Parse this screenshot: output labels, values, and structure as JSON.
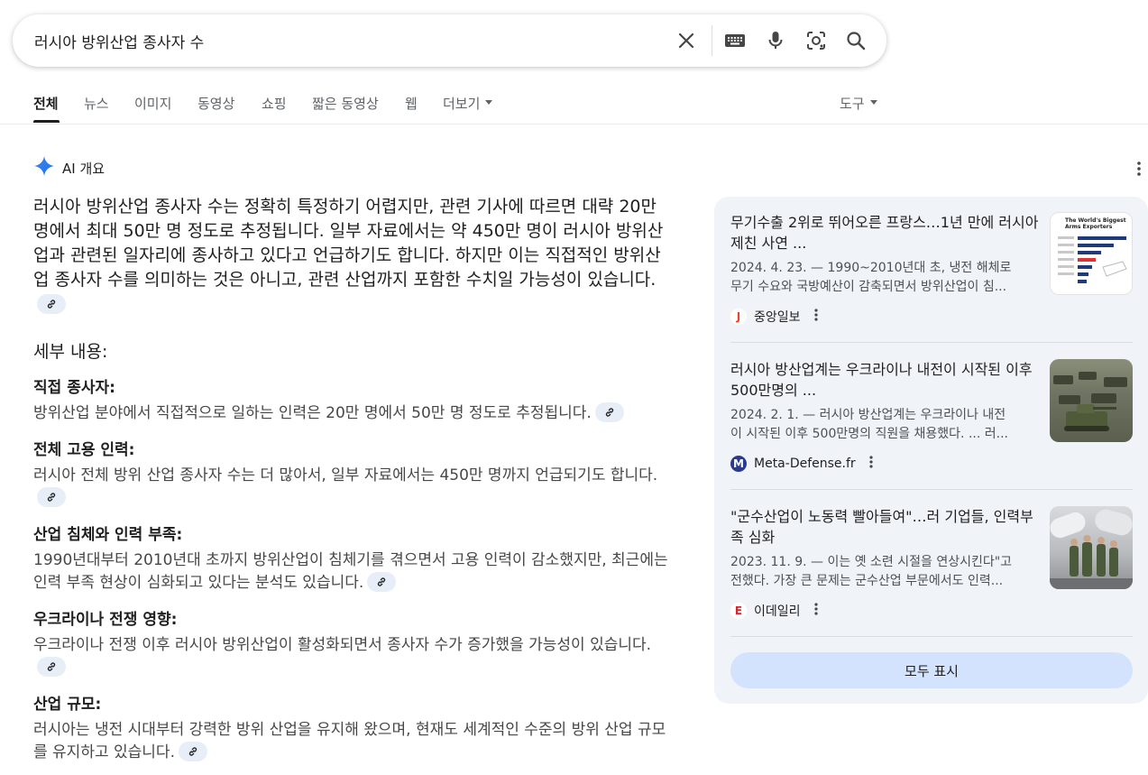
{
  "search": {
    "query": "러시아 방위산업 종사자 수"
  },
  "tabs": [
    {
      "label": "전체"
    },
    {
      "label": "뉴스"
    },
    {
      "label": "이미지"
    },
    {
      "label": "동영상"
    },
    {
      "label": "쇼핑"
    },
    {
      "label": "짧은 동영상"
    },
    {
      "label": "웹"
    },
    {
      "label": "더보기"
    }
  ],
  "tools_label": "도구",
  "ai_overview": {
    "label": "AI 개요",
    "summary": "러시아 방위산업 종사자 수는 정확히 특정하기 어렵지만, 관련 기사에 따르면 대략 20만 명에서 최대 50만 명 정도로 추정됩니다. 일부 자료에서는 약 450만 명이 러시아 방위산업과 관련된 일자리에 종사하고 있다고 언급하기도 합니다. 하지만 이는 직접적인 방위산업 종사자 수를 의미하는 것은 아니고, 관련 산업까지 포함한 수치일 가능성이 있습니다.",
    "details_title": "세부 내용:",
    "items": [
      {
        "title": "직접 종사자:",
        "body": "방위산업 분야에서 직접적으로 일하는 인력은 20만 명에서 50만 명 정도로 추정됩니다."
      },
      {
        "title": "전체 고용 인력:",
        "body": "러시아 전체 방위 산업 종사자 수는 더 많아서, 일부 자료에서는 450만 명까지 언급되기도 합니다."
      },
      {
        "title": "산업 침체와 인력 부족:",
        "body": "1990년대부터 2010년대 초까지 방위산업이 침체기를 겪으면서 고용 인력이 감소했지만, 최근에는 인력 부족 현상이 심화되고 있다는 분석도 있습니다."
      },
      {
        "title": "우크라이나 전쟁 영향:",
        "body": "우크라이나 전쟁 이후 러시아 방위산업이 활성화되면서 종사자 수가 증가했을 가능성이 있습니다."
      },
      {
        "title": "산업 규모:",
        "body": "러시아는 냉전 시대부터 강력한 방위 산업을 유지해 왔으며, 현재도 세계적인 수준의 방위 산업 규모를 유지하고 있습니다."
      }
    ]
  },
  "sources": [
    {
      "title": "무기수출 2위로 뛰어오른 프랑스…1년 만에 러시아 제친 사연 ...",
      "snippet_line1": "2024. 4. 23. — 1990~2010년대 초, 냉전 해체로",
      "snippet_line2": "무기 수요와 국방예산이 감축되면서 방위산업이 침...",
      "source": "중앙일보",
      "logo_letter": "J",
      "logo_color": "#e8442e",
      "thumb_text_1": "The World's Biggest",
      "thumb_text_2": "Arms Exporters"
    },
    {
      "title": "러시아 방산업계는 우크라이나 내전이 시작된 이후 500만명의 ...",
      "snippet_line1": "2024. 2. 1. — 러시아 방산업계는 우크라이나 내전",
      "snippet_line2": "이 시작된 이후 500만명의 직원을 채용했다. ... 러...",
      "source": "Meta-Defense.fr",
      "logo_letter": "M",
      "logo_color": "#2b3a8c"
    },
    {
      "title": "\"군수산업이 노동력 빨아들여\"…러 기업들, 인력부족 심화",
      "snippet_line1": "2023. 11. 9. — 이는 옛 소련 시절을 연상시킨다\"고",
      "snippet_line2": "전했다. 가장 큰 문제는 군수산업 부문에서도 인력...",
      "source": "이데일리",
      "logo_letter": "E",
      "logo_color": "#d9232d"
    }
  ],
  "show_all_label": "모두 표시",
  "colors": {
    "accent": "#1a73e8",
    "chip": "#e8eef8",
    "sidebar_bg": "#f0f4f9",
    "show_all_bg": "#d3e3fd"
  }
}
